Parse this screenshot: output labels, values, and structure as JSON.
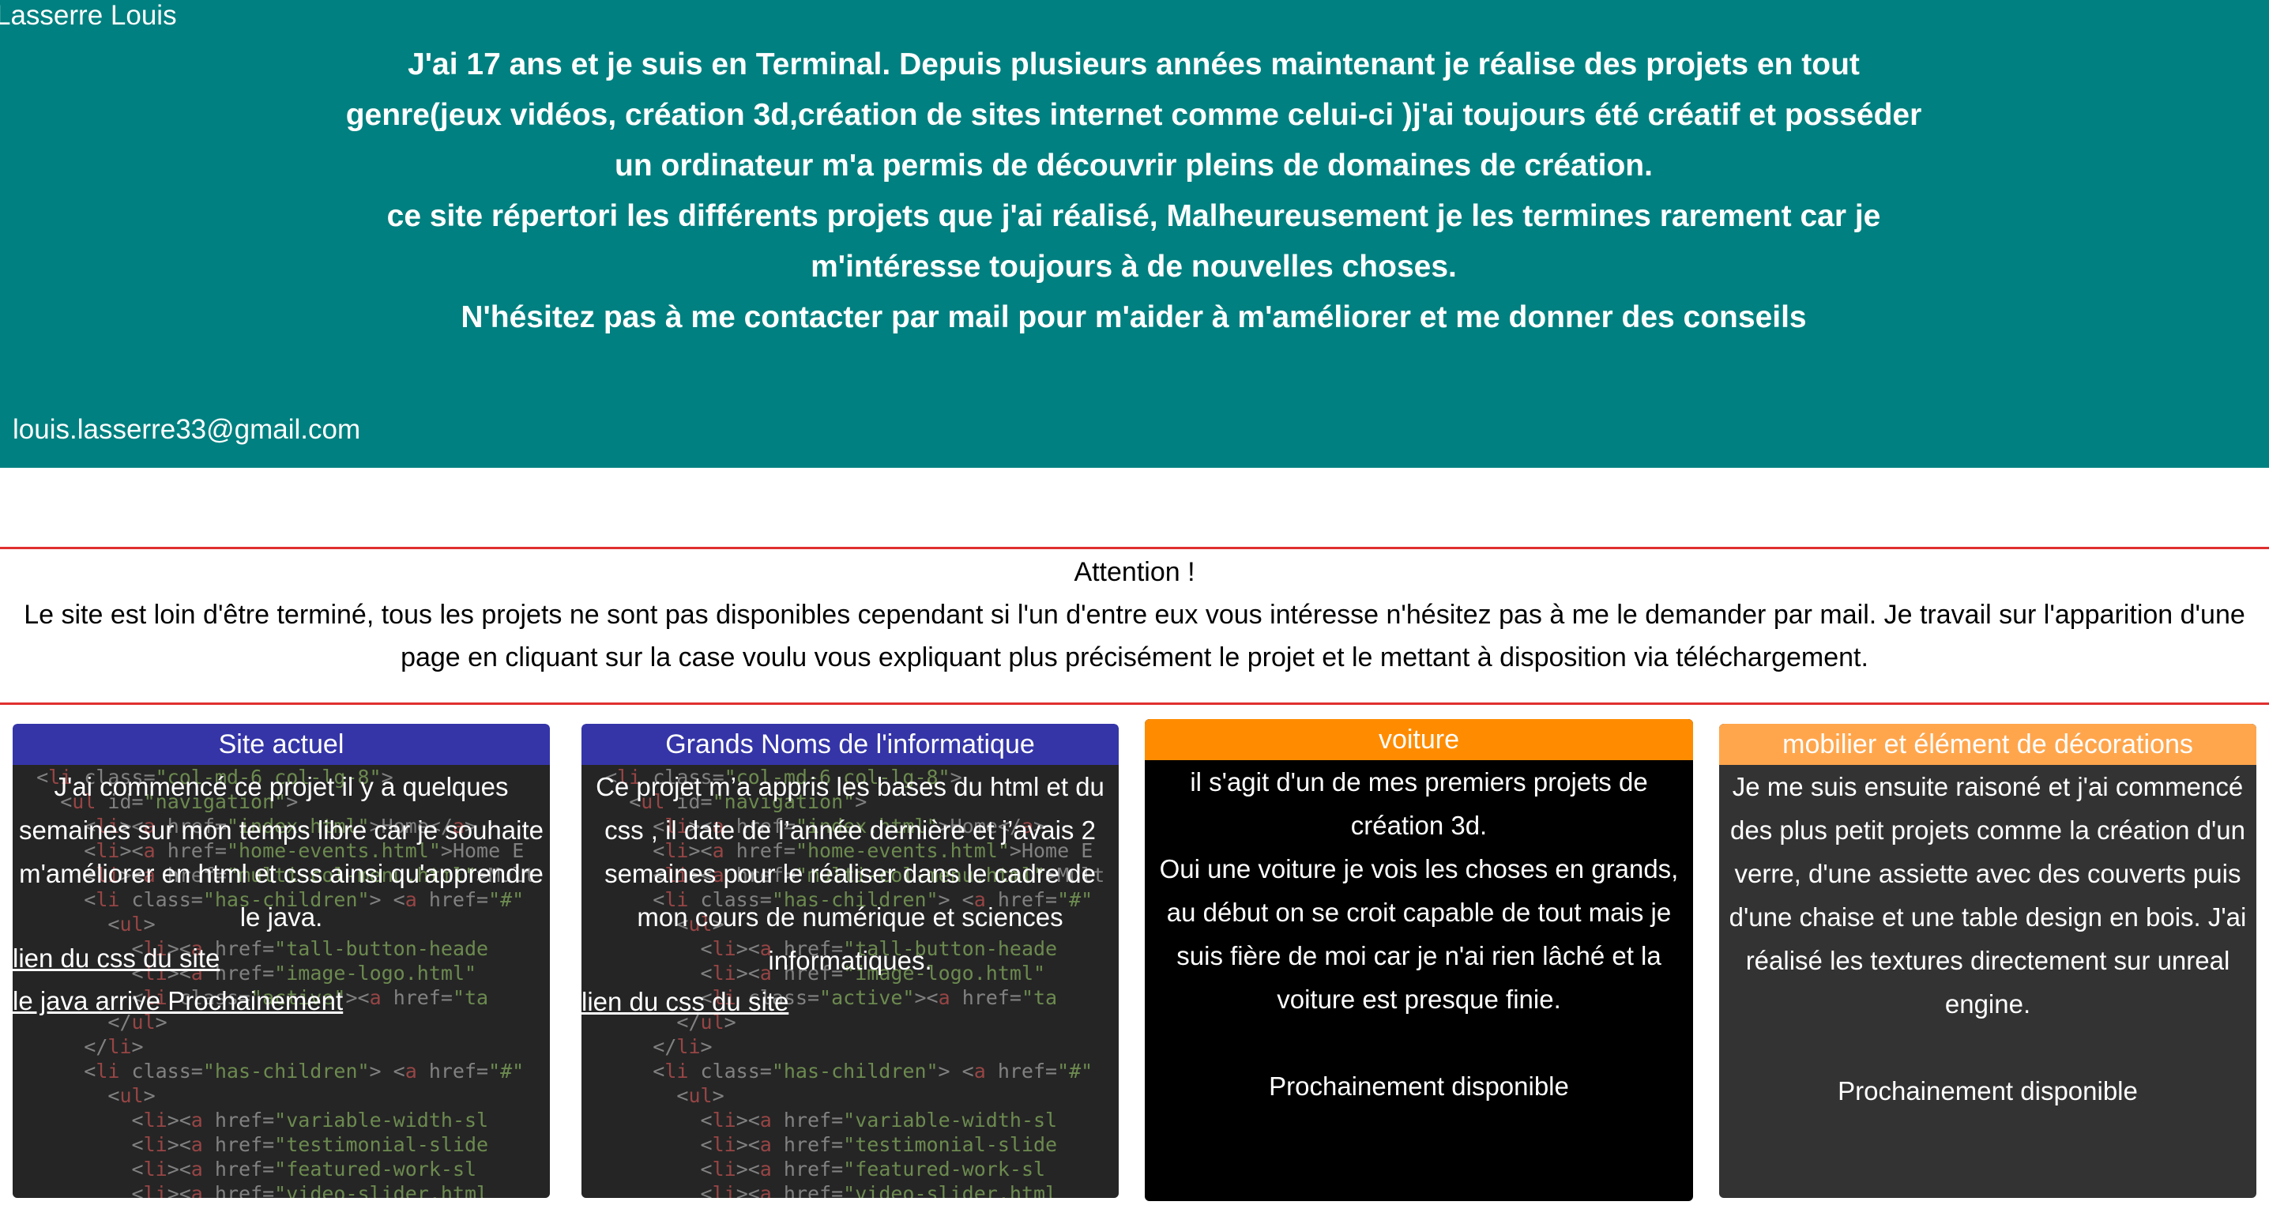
{
  "header": {
    "name": "Lasserre Louis",
    "intro": [
      "J'ai 17 ans et je suis en Terminal. Depuis plusieurs années maintenant je réalise des projets en tout genre(jeux vidéos, création 3d,création de sites internet comme celui-ci )j'ai toujours été créatif et posséder un ordinateur m'a permis de découvrir pleins de domaines de création.",
      "ce site répertori les différents projets que j'ai réalisé, Malheureusement je les termines rarement car je m'intéresse toujours à de nouvelles choses.",
      "N'hésitez pas à me contacter par mail pour m'aider à m'améliorer et me donner des conseils"
    ],
    "email": "louis.lasserre33@gmail.com"
  },
  "warning": {
    "title": "Attention !",
    "body": "Le site est loin d'être terminé, tous les projets ne sont pas disponibles cependant si l'un d'entre eux vous intéresse n'hésitez pas à me le demander par mail. Je travail sur l'apparition d'une page en cliquant sur la case voulu vous expliquant plus précisément le projet et le mettant à disposition via téléchargement."
  },
  "cards": [
    {
      "title": "Site actuel",
      "text": "J'ai commencé ce projet il y a quelques semaines sur mon temps libre car je souhaite m'améliorer en html et css ainsi qu'apprendre le java.",
      "links": [
        "lien du css du site",
        "le java arrive Prochainement"
      ]
    },
    {
      "title": "Grands Noms de l'informatique",
      "text": "Ce projet m’a appris les bases du html et du css , il date de l’année dernière et j’avais 2 semaines pour le réaliser dans le cadre de mon cours de numérique et sciences informatiques.",
      "links": [
        "lien du css du site"
      ]
    },
    {
      "title": "voiture",
      "text1": "il s'agit d'un de mes premiers projets de création 3d.",
      "text2": "Oui une voiture je vois les choses en grands, au début on se croit capable de tout mais je suis fière de moi car je n'ai rien lâché et la voiture est presque finie.",
      "status": "Prochainement disponible"
    },
    {
      "title": "mobilier et élément de décorations",
      "text": "Je me suis ensuite raisoné et j'ai commencé des plus petit projets comme la création d'un verre, d'une assiette avec des couverts puis d'une chaise et une table design en bois. J'ai réalisé les textures directement sur unreal engine.",
      "status": "Prochainement disponible"
    }
  ],
  "colors": {
    "header_bg": "#008080",
    "card_title_blue": "#3535a8",
    "card_title_orange": "#ff8c00",
    "card_title_light_orange": "#ffa64d",
    "warning_border": "#e03030"
  }
}
